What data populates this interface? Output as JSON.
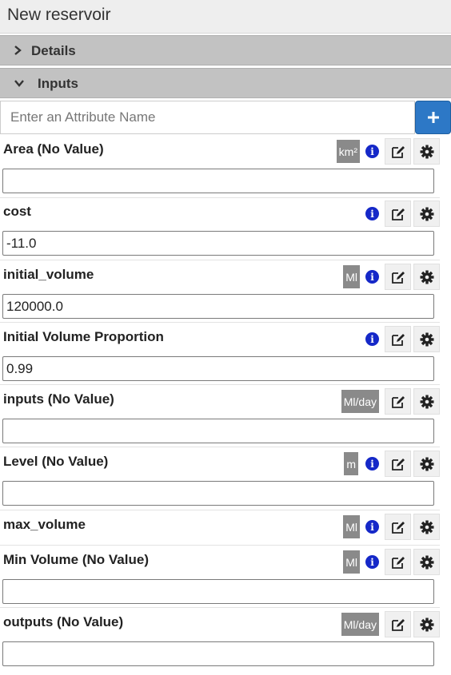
{
  "window": {
    "title": "New reservoir"
  },
  "sections": {
    "details": {
      "label": "Details",
      "expanded": false
    },
    "inputs": {
      "label": "Inputs",
      "expanded": true
    }
  },
  "search": {
    "placeholder": "Enter an Attribute Name",
    "value": "",
    "add_icon": "plus-icon"
  },
  "attributes": [
    {
      "name": "Area (No Value)",
      "unit": "km²",
      "info": "i",
      "value": ""
    },
    {
      "name": "cost",
      "unit": "",
      "info": "i",
      "value": "-11.0"
    },
    {
      "name": "initial_volume",
      "unit": "Ml",
      "info": "i",
      "value": "120000.0"
    },
    {
      "name": "Initial Volume Proportion",
      "unit": "",
      "info": "i",
      "value": "0.99"
    },
    {
      "name": "inputs (No Value)",
      "unit": "Ml/day",
      "info": "",
      "value": ""
    },
    {
      "name": "Level (No Value)",
      "unit": "m",
      "info": "i",
      "value": ""
    },
    {
      "name": "max_volume",
      "unit": "Ml",
      "info": "i",
      "value": null
    },
    {
      "name": "Min Volume (No Value)",
      "unit": "Ml",
      "info": "i",
      "value": ""
    },
    {
      "name": "outputs (No Value)",
      "unit": "Ml/day",
      "info": "",
      "value": ""
    }
  ],
  "icons": {
    "edit": "edit-icon",
    "settings": "gear-icon",
    "info": "info-icon"
  },
  "colors": {
    "add_button": "#2d78c6",
    "info_icon": "#1528c8",
    "section_header": "#c2c2c2",
    "unit_badge": "#8a8a8a"
  }
}
